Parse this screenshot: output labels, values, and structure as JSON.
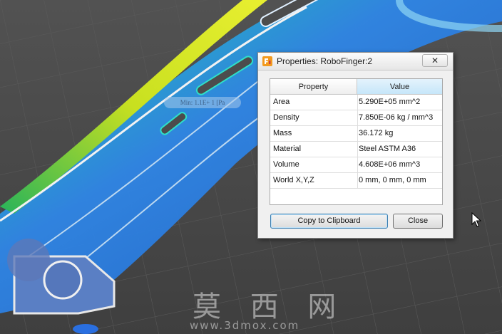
{
  "dialog": {
    "title": "Properties: RoboFinger:2",
    "close_glyph": "✕",
    "columns": {
      "property": "Property",
      "value": "Value"
    },
    "rows": [
      {
        "property": "Area",
        "value": "5.290E+05 mm^2"
      },
      {
        "property": "Density",
        "value": "7.850E-06 kg / mm^3"
      },
      {
        "property": "Mass",
        "value": "36.172 kg"
      },
      {
        "property": "Material",
        "value": "Steel ASTM A36"
      },
      {
        "property": "Volume",
        "value": "4.608E+06 mm^3"
      },
      {
        "property": "World X,Y,Z",
        "value": "0 mm, 0 mm, 0 mm"
      }
    ],
    "buttons": {
      "copy": "Copy to Clipboard",
      "close": "Close"
    }
  },
  "viewport": {
    "tooltip": "Min: 1.1E+ 1 [Pa",
    "watermark_title": "莫 西 网",
    "watermark_url": "www.3dmox.com"
  },
  "colors": {
    "background": "#4a4a4a",
    "stress_low": "#2c7fe0",
    "stress_mid": "#2fd3c4",
    "stress_high": "#e4e400",
    "accent_header": "#c6e6f9"
  },
  "icons": {
    "app": "fusion-app-icon",
    "close": "close-icon",
    "cursor": "mouse-pointer-icon"
  }
}
